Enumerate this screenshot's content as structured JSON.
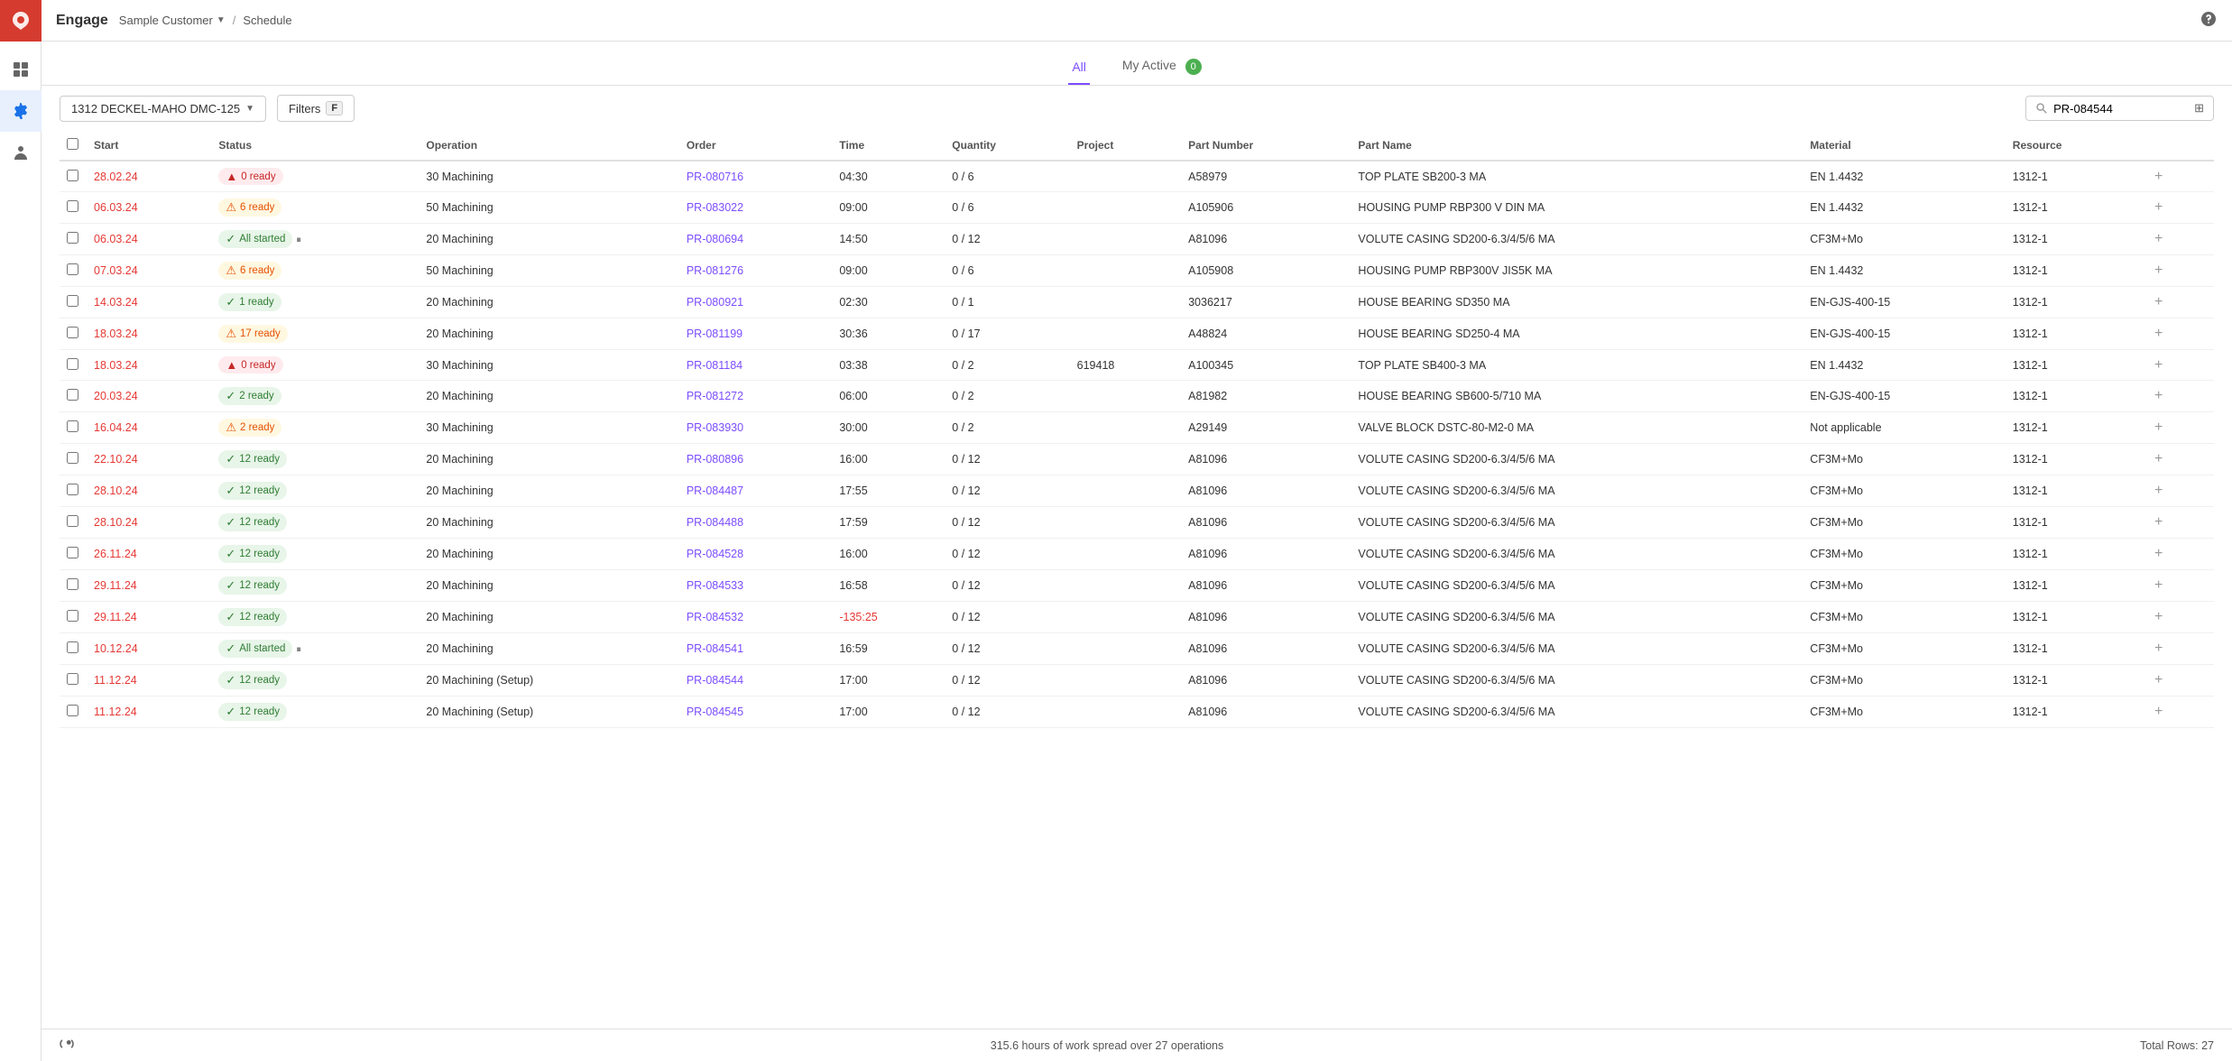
{
  "app": {
    "name": "Engage",
    "customer": "Sample Customer",
    "breadcrumb": "Schedule"
  },
  "tabs": [
    {
      "id": "all",
      "label": "All",
      "active": true
    },
    {
      "id": "my-active",
      "label": "My Active",
      "badge": "0",
      "active": false
    }
  ],
  "toolbar": {
    "machine_dropdown": "1312 DECKEL-MAHO DMC-125",
    "filter_label": "Filters",
    "filter_key": "F",
    "search_placeholder": "PR-084544",
    "search_value": "PR-084544"
  },
  "table": {
    "columns": [
      "Start",
      "Status",
      "Operation",
      "Order",
      "Time",
      "Quantity",
      "Project",
      "Part Number",
      "Part Name",
      "Material",
      "Resource"
    ],
    "rows": [
      {
        "start": "28.02.24",
        "status_text": "0 ready",
        "status_type": "error",
        "icon": "alert",
        "operation": "30 Machining",
        "order": "PR-080716",
        "time": "04:30",
        "quantity": "0 / 6",
        "project": "",
        "part_number": "A58979",
        "part_name": "TOP PLATE SB200-3 MA",
        "material": "EN 1.4432",
        "resource": "1312-1"
      },
      {
        "start": "06.03.24",
        "status_text": "6 ready",
        "status_type": "warning",
        "icon": "warning",
        "operation": "50 Machining",
        "order": "PR-083022",
        "time": "09:00",
        "quantity": "0 / 6",
        "project": "",
        "part_number": "A105906",
        "part_name": "HOUSING PUMP RBP300 V DIN MA",
        "material": "EN 1.4432",
        "resource": "1312-1"
      },
      {
        "start": "06.03.24",
        "status_text": "All started",
        "status_type": "all-started",
        "icon": "check",
        "pause": true,
        "operation": "20 Machining",
        "order": "PR-080694",
        "time": "14:50",
        "quantity": "0 / 12",
        "project": "",
        "part_number": "A81096",
        "part_name": "VOLUTE CASING SD200-6.3/4/5/6 MA",
        "material": "CF3M+Mo",
        "resource": "1312-1"
      },
      {
        "start": "07.03.24",
        "status_text": "6 ready",
        "status_type": "warning",
        "icon": "warning",
        "operation": "50 Machining",
        "order": "PR-081276",
        "time": "09:00",
        "quantity": "0 / 6",
        "project": "",
        "part_number": "A105908",
        "part_name": "HOUSING PUMP RBP300V JIS5K MA",
        "material": "EN 1.4432",
        "resource": "1312-1"
      },
      {
        "start": "14.03.24",
        "status_text": "1 ready",
        "status_type": "ready",
        "icon": "check",
        "operation": "20 Machining",
        "order": "PR-080921",
        "time": "02:30",
        "quantity": "0 / 1",
        "project": "",
        "part_number": "3036217",
        "part_name": "HOUSE BEARING SD350 MA",
        "material": "EN-GJS-400-15",
        "resource": "1312-1"
      },
      {
        "start": "18.03.24",
        "status_text": "17 ready",
        "status_type": "warning",
        "icon": "warning",
        "operation": "20 Machining",
        "order": "PR-081199",
        "time": "30:36",
        "quantity": "0 / 17",
        "project": "",
        "part_number": "A48824",
        "part_name": "HOUSE BEARING SD250-4 MA",
        "material": "EN-GJS-400-15",
        "resource": "1312-1"
      },
      {
        "start": "18.03.24",
        "status_text": "0 ready",
        "status_type": "error",
        "icon": "alert",
        "operation": "30 Machining",
        "order": "PR-081184",
        "time": "03:38",
        "quantity": "0 / 2",
        "project": "619418",
        "part_number": "A100345",
        "part_name": "TOP PLATE SB400-3 MA",
        "material": "EN 1.4432",
        "resource": "1312-1"
      },
      {
        "start": "20.03.24",
        "status_text": "2 ready",
        "status_type": "ready",
        "icon": "check",
        "operation": "20 Machining",
        "order": "PR-081272",
        "time": "06:00",
        "quantity": "0 / 2",
        "project": "",
        "part_number": "A81982",
        "part_name": "HOUSE BEARING SB600-5/710 MA",
        "material": "EN-GJS-400-15",
        "resource": "1312-1"
      },
      {
        "start": "16.04.24",
        "status_text": "2 ready",
        "status_type": "warning",
        "icon": "warning",
        "operation": "30 Machining",
        "order": "PR-083930",
        "time": "30:00",
        "quantity": "0 / 2",
        "project": "",
        "part_number": "A29149",
        "part_name": "VALVE BLOCK DSTC-80-M2-0 MA",
        "material": "Not applicable",
        "resource": "1312-1"
      },
      {
        "start": "22.10.24",
        "status_text": "12 ready",
        "status_type": "ready",
        "icon": "check",
        "operation": "20 Machining",
        "order": "PR-080896",
        "time": "16:00",
        "quantity": "0 / 12",
        "project": "",
        "part_number": "A81096",
        "part_name": "VOLUTE CASING SD200-6.3/4/5/6 MA",
        "material": "CF3M+Mo",
        "resource": "1312-1"
      },
      {
        "start": "28.10.24",
        "status_text": "12 ready",
        "status_type": "ready",
        "icon": "check",
        "operation": "20 Machining",
        "order": "PR-084487",
        "time": "17:55",
        "quantity": "0 / 12",
        "project": "",
        "part_number": "A81096",
        "part_name": "VOLUTE CASING SD200-6.3/4/5/6 MA",
        "material": "CF3M+Mo",
        "resource": "1312-1"
      },
      {
        "start": "28.10.24",
        "status_text": "12 ready",
        "status_type": "ready",
        "icon": "check",
        "operation": "20 Machining",
        "order": "PR-084488",
        "time": "17:59",
        "quantity": "0 / 12",
        "project": "",
        "part_number": "A81096",
        "part_name": "VOLUTE CASING SD200-6.3/4/5/6 MA",
        "material": "CF3M+Mo",
        "resource": "1312-1"
      },
      {
        "start": "26.11.24",
        "status_text": "12 ready",
        "status_type": "ready",
        "icon": "check",
        "operation": "20 Machining",
        "order": "PR-084528",
        "time": "16:00",
        "quantity": "0 / 12",
        "project": "",
        "part_number": "A81096",
        "part_name": "VOLUTE CASING SD200-6.3/4/5/6 MA",
        "material": "CF3M+Mo",
        "resource": "1312-1"
      },
      {
        "start": "29.11.24",
        "status_text": "12 ready",
        "status_type": "ready",
        "icon": "check",
        "operation": "20 Machining",
        "order": "PR-084533",
        "time": "16:58",
        "quantity": "0 / 12",
        "project": "",
        "part_number": "A81096",
        "part_name": "VOLUTE CASING SD200-6.3/4/5/6 MA",
        "material": "CF3M+Mo",
        "resource": "1312-1"
      },
      {
        "start": "29.11.24",
        "status_text": "12 ready",
        "status_type": "ready",
        "icon": "check",
        "operation": "20 Machining",
        "order": "PR-084532",
        "time": "-135:25",
        "time_neg": true,
        "quantity": "0 / 12",
        "project": "",
        "part_number": "A81096",
        "part_name": "VOLUTE CASING SD200-6.3/4/5/6 MA",
        "material": "CF3M+Mo",
        "resource": "1312-1"
      },
      {
        "start": "10.12.24",
        "status_text": "All started",
        "status_type": "all-started",
        "icon": "check",
        "pause": true,
        "operation": "20 Machining",
        "order": "PR-084541",
        "time": "16:59",
        "quantity": "0 / 12",
        "project": "",
        "part_number": "A81096",
        "part_name": "VOLUTE CASING SD200-6.3/4/5/6 MA",
        "material": "CF3M+Mo",
        "resource": "1312-1"
      },
      {
        "start": "11.12.24",
        "status_text": "12 ready",
        "status_type": "ready",
        "icon": "check",
        "operation": "20 Machining (Setup)",
        "order": "PR-084544",
        "time": "17:00",
        "quantity": "0 / 12",
        "project": "",
        "part_number": "A81096",
        "part_name": "VOLUTE CASING SD200-6.3/4/5/6 MA",
        "material": "CF3M+Mo",
        "resource": "1312-1"
      },
      {
        "start": "11.12.24",
        "status_text": "12 ready",
        "status_type": "ready",
        "icon": "check",
        "operation": "20 Machining (Setup)",
        "order": "PR-084545",
        "time": "17:00",
        "quantity": "0 / 12",
        "project": "",
        "part_number": "A81096",
        "part_name": "VOLUTE CASING SD200-6.3/4/5/6 MA",
        "material": "CF3M+Mo",
        "resource": "1312-1"
      }
    ]
  },
  "footer": {
    "summary": "315.6 hours of work spread over 27 operations",
    "total_rows": "Total Rows: 27"
  },
  "sidebar": {
    "items": [
      {
        "id": "apps",
        "icon": "grid"
      },
      {
        "id": "settings",
        "icon": "gear",
        "active": true
      },
      {
        "id": "user",
        "icon": "user"
      }
    ]
  }
}
